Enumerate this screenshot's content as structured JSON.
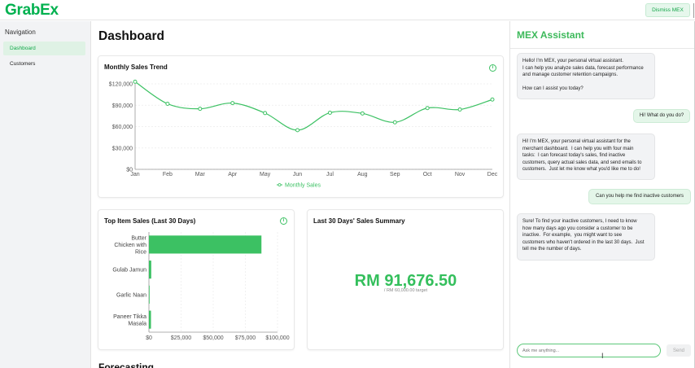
{
  "app": {
    "logo": "GrabEx",
    "dismiss_label": "Dismiss MEX"
  },
  "sidebar": {
    "title": "Navigation",
    "items": [
      {
        "label": "Dashboard",
        "active": true
      },
      {
        "label": "Customers",
        "active": false
      }
    ]
  },
  "main": {
    "title": "Dashboard",
    "next_section_peek": "Forecasting",
    "monthly_card": {
      "title": "Monthly Sales Trend"
    },
    "top_items_card": {
      "title": "Top Item Sales (Last 30 Days)"
    },
    "summary_card": {
      "title": "Last 30 Days' Sales Summary",
      "value": "RM 91,676.50",
      "target": "/ RM 60,000.00 target"
    }
  },
  "chart_data": [
    {
      "type": "line",
      "title": "Monthly Sales Trend",
      "x": [
        "Jan",
        "Feb",
        "Mar",
        "Apr",
        "May",
        "Jun",
        "Jul",
        "Aug",
        "Sep",
        "Oct",
        "Nov",
        "Dec"
      ],
      "series": [
        {
          "name": "Monthly Sales",
          "values": [
            123000,
            92000,
            85000,
            93000,
            79000,
            55000,
            79500,
            78500,
            66000,
            86000,
            84000,
            98000
          ]
        }
      ],
      "yticks": [
        "$0",
        "$30,000",
        "$60,000",
        "$90,000",
        "$120,000"
      ],
      "ylim": [
        0,
        120000
      ],
      "legend": "bottom",
      "color": "#3cc163"
    },
    {
      "type": "bar",
      "orientation": "horizontal",
      "title": "Top Item Sales (Last 30 Days)",
      "categories": [
        "Butter Chicken with Rice",
        "Gulab Jamun",
        "Garlic Naan",
        "Paneer Tikka Masala"
      ],
      "values": [
        87500,
        1800,
        300,
        1600
      ],
      "xticks": [
        "$0",
        "$25,000",
        "$50,000",
        "$75,000",
        "$100,000"
      ],
      "xlim": [
        0,
        100000
      ],
      "color": "#3cc163"
    }
  ],
  "assistant": {
    "title": "MEX Assistant",
    "messages": [
      {
        "role": "bot",
        "text": "Hello! I'm MEX, your personal virtual assistant.\nI can help you analyze sales data, forecast performance\nand manage customer retention campaigns.\n\nHow can I assist you today?"
      },
      {
        "role": "user",
        "text": "Hi! What do you do?"
      },
      {
        "role": "bot",
        "text": "Hi! I'm MEX, your personal virtual assistant for the\nmerchant dashboard.  I can help you with four main\ntasks:  I can forecast today's sales, find inactive\ncustomers, query actual sales data, and send emails to\ncustomers.  Just let me know what you'd like me to do!"
      },
      {
        "role": "user",
        "text": "Can you help me find inactive customers"
      },
      {
        "role": "bot",
        "text": "Sure! To find your inactive customers, I need to know\nhow many days ago you consider a customer to be\ninactive.  For example,  you might want to see\ncustomers who haven't ordered in the last 30 days.  Just\ntell me the number of days."
      }
    ],
    "input_placeholder": "Ask me anything...",
    "send_label": "Send"
  },
  "colors": {
    "brand": "#00b14f",
    "accent": "#3cc163"
  }
}
